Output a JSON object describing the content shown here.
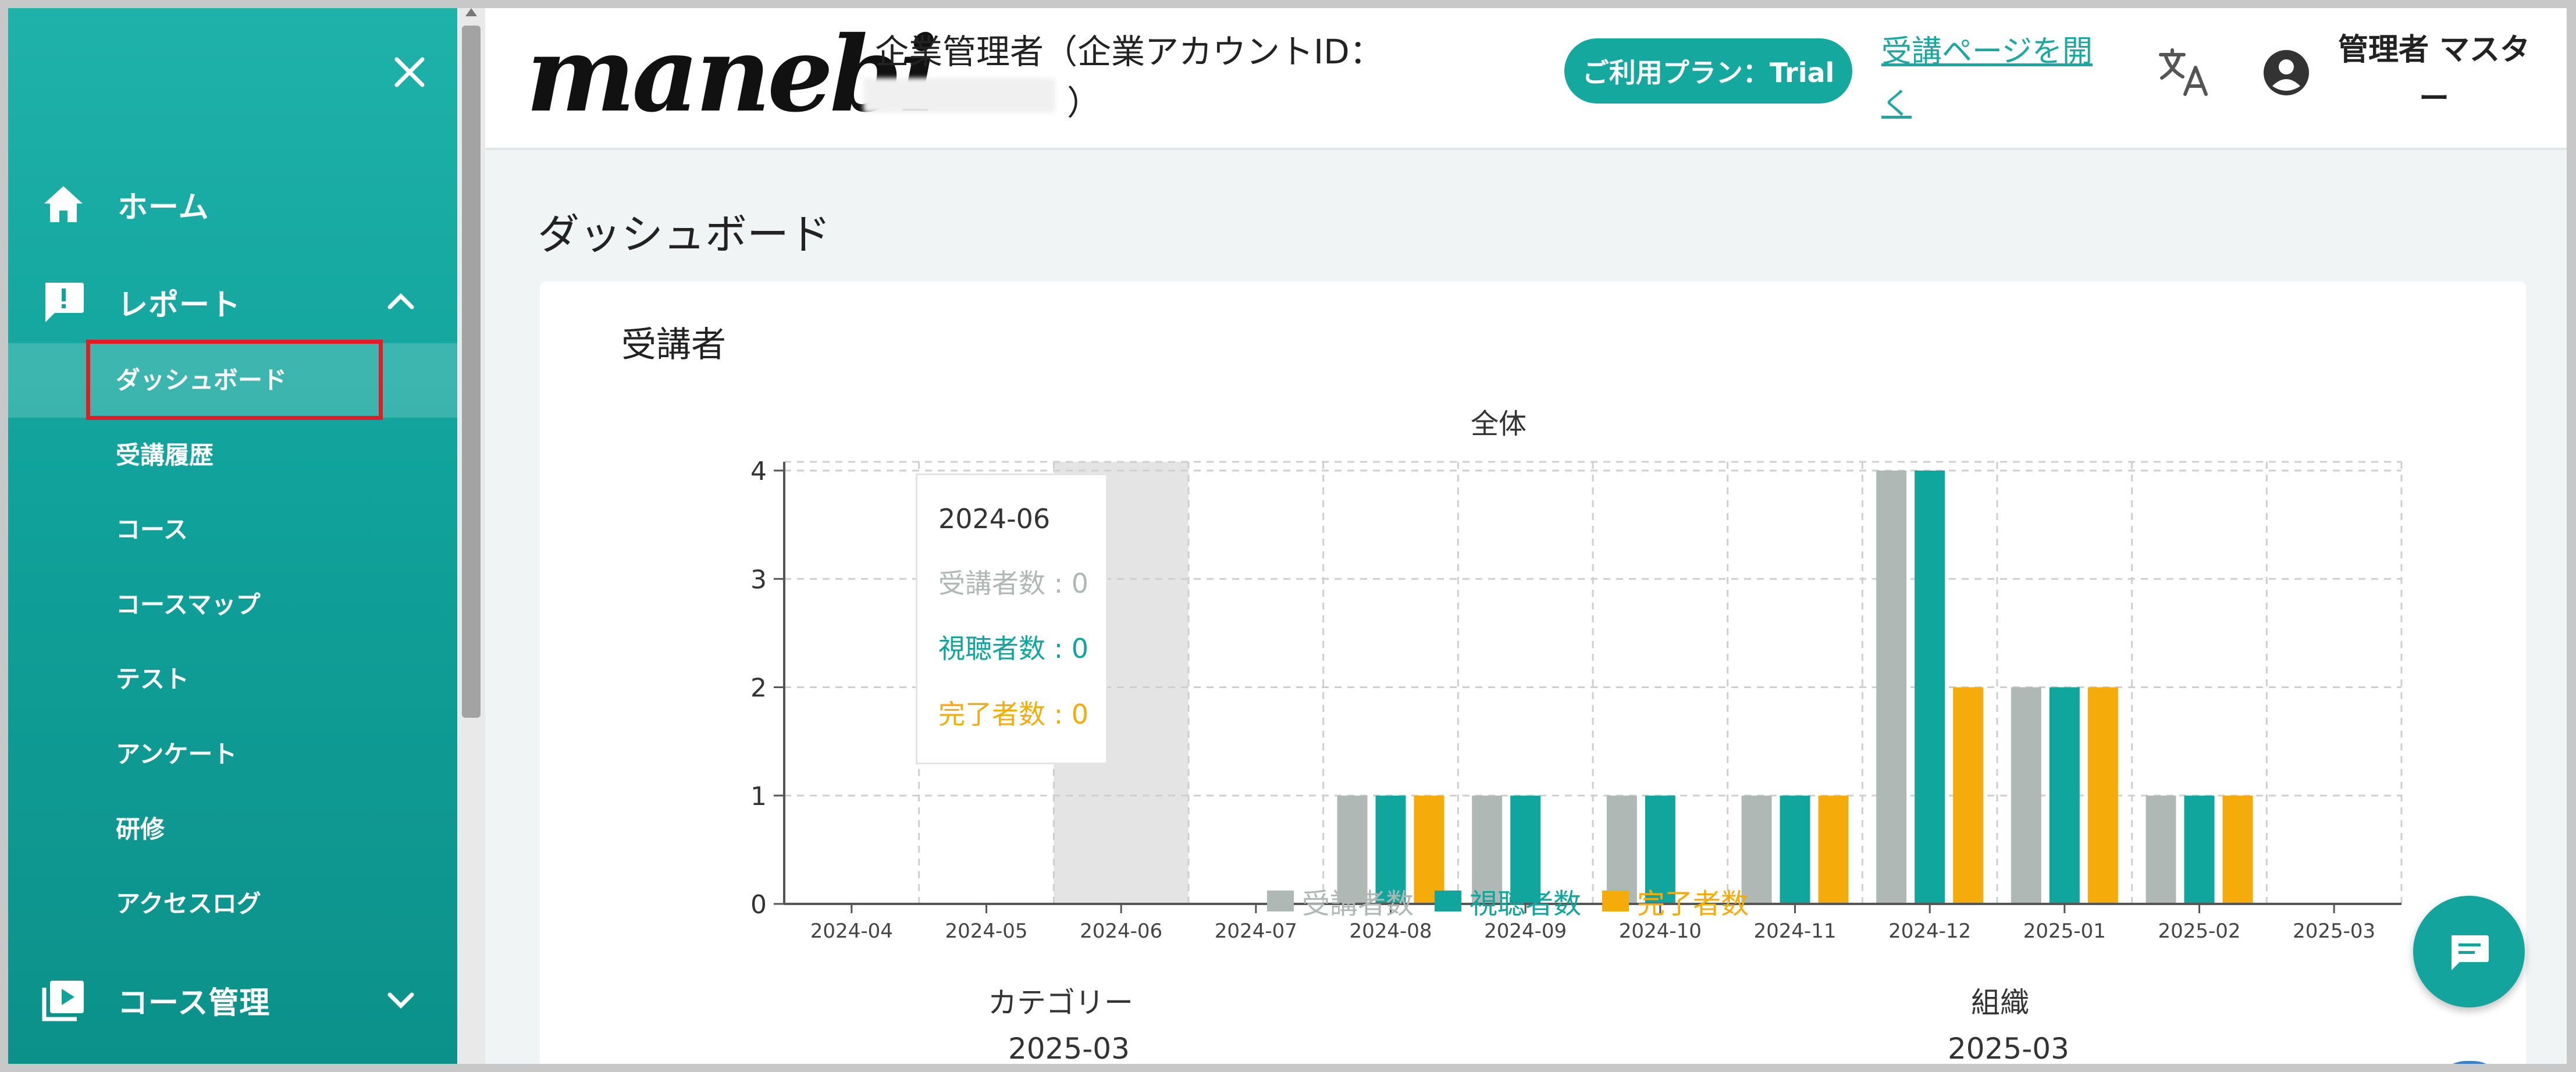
{
  "sidebar": {
    "items": [
      {
        "label": "ホーム",
        "icon": "home-icon"
      },
      {
        "label": "レポート",
        "icon": "report-icon"
      },
      {
        "label": "コース管理",
        "icon": "course-play-icon"
      }
    ],
    "report_subitems": [
      "ダッシュボード",
      "受講履歴",
      "コース",
      "コースマップ",
      "テスト",
      "アンケート",
      "研修",
      "アクセスログ"
    ],
    "active_subitem": "ダッシュボード"
  },
  "header": {
    "logo": "manebi",
    "company_label": "企業管理者（企業アカウントID：",
    "company_close": "）",
    "plan_badge": "ご利用プラン：Trial",
    "learn_link": "受講ページを開く",
    "user_name": "管理者 マスター"
  },
  "main": {
    "page_title": "ダッシュボード",
    "card_title": "受講者",
    "category_label": "カテゴリー",
    "category_month": "2025-03",
    "org_label": "組織",
    "org_month": "2025-03"
  },
  "tooltip": {
    "month": "2024-06",
    "lines": [
      "受講者数 : 0",
      "視聴者数 : 0",
      "完了者数 : 0"
    ]
  },
  "colors": {
    "accent": "#14a89f",
    "series_enrolled": "#b0b8b6",
    "series_viewers": "#10a69e",
    "series_completed": "#f5ac0a",
    "highlight_box": "#e51b23"
  },
  "chart_data": {
    "type": "bar",
    "title": "全体",
    "categories": [
      "2024-04",
      "2024-05",
      "2024-06",
      "2024-07",
      "2024-08",
      "2024-09",
      "2024-10",
      "2024-11",
      "2024-12",
      "2025-01",
      "2025-02",
      "2025-03"
    ],
    "series": [
      {
        "name": "受講者数",
        "values": [
          0,
          0,
          0,
          0,
          1,
          1,
          1,
          1,
          4,
          2,
          1,
          0
        ]
      },
      {
        "name": "視聴者数",
        "values": [
          0,
          0,
          0,
          0,
          1,
          1,
          1,
          1,
          4,
          2,
          1,
          0
        ]
      },
      {
        "name": "完了者数",
        "values": [
          0,
          0,
          0,
          0,
          1,
          0,
          0,
          1,
          2,
          2,
          1,
          0
        ]
      }
    ],
    "yticks": [
      0,
      1,
      2,
      3,
      4
    ],
    "ylim": [
      0,
      4
    ],
    "grid": true,
    "legend": "bottom",
    "highlighted_category": "2024-06"
  }
}
